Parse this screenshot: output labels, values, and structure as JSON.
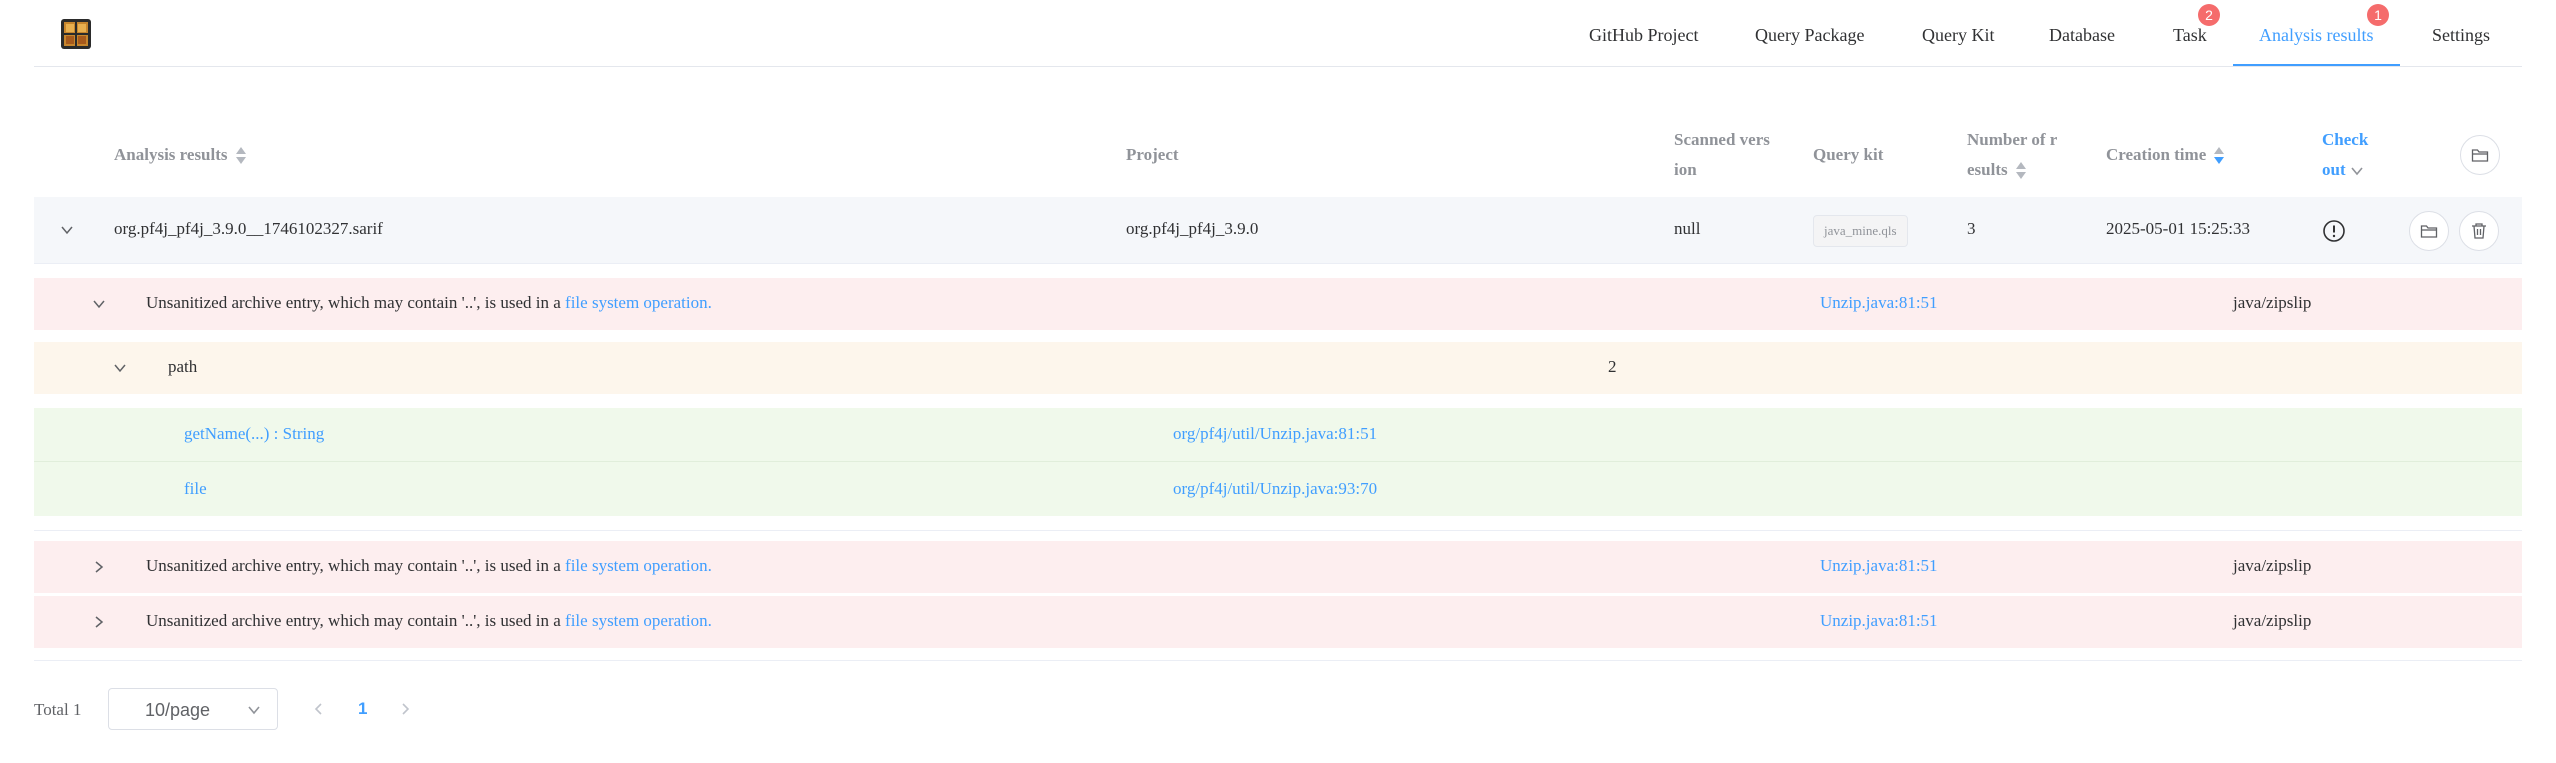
{
  "nav": {
    "items": [
      {
        "label": "GitHub Project"
      },
      {
        "label": "Query Package"
      },
      {
        "label": "Query Kit"
      },
      {
        "label": "Database"
      },
      {
        "label": "Task",
        "badge": "2"
      },
      {
        "label": "Analysis results",
        "badge": "1",
        "active": true
      },
      {
        "label": "Settings"
      }
    ]
  },
  "table": {
    "headers": {
      "analysis_results": "Analysis results",
      "project": "Project",
      "scanned_version_1": "Scanned vers",
      "scanned_version_2": "ion",
      "query_kit": "Query kit",
      "num_results_1": "Number of r",
      "num_results_2": "esults",
      "creation_time": "Creation time",
      "check_out_1": "Check",
      "check_out_2": "out"
    },
    "row": {
      "analysis_result": "org.pf4j_pf4j_3.9.0__1746102327.sarif",
      "project": "org.pf4j_pf4j_3.9.0",
      "scanned_version": "null",
      "query_kit": "java_mine.qls",
      "num_results": "3",
      "creation_time": "2025-05-01 15:25:33"
    }
  },
  "alerts": [
    {
      "message": "Unsanitized archive entry, which may contain '..', is used in a ",
      "link": "file system operation",
      "suffix": ".",
      "location": "Unzip.java:81:51",
      "rule": "java/zipslip",
      "expanded": true
    },
    {
      "message": "Unsanitized archive entry, which may contain '..', is used in a ",
      "link": "file system operation",
      "suffix": ".",
      "location": "Unzip.java:81:51",
      "rule": "java/zipslip",
      "expanded": false
    },
    {
      "message": "Unsanitized archive entry, which may contain '..', is used in a ",
      "link": "file system operation",
      "suffix": ".",
      "location": "Unzip.java:81:51",
      "rule": "java/zipslip",
      "expanded": false
    }
  ],
  "path": {
    "label": "path",
    "count": "2",
    "steps": [
      {
        "name": "getName(...) : String",
        "location": "org/pf4j/util/Unzip.java:81:51"
      },
      {
        "name": "file",
        "location": "org/pf4j/util/Unzip.java:93:70"
      }
    ]
  },
  "pagination": {
    "total": "Total 1",
    "page_size": "10/page",
    "current_page": "1"
  },
  "colors": {
    "accent": "#409eff",
    "badge": "#f56c6c",
    "alert_bg": "#fdeeef",
    "path_bg": "#fdf6ec",
    "step_bg": "#f0f9eb"
  }
}
